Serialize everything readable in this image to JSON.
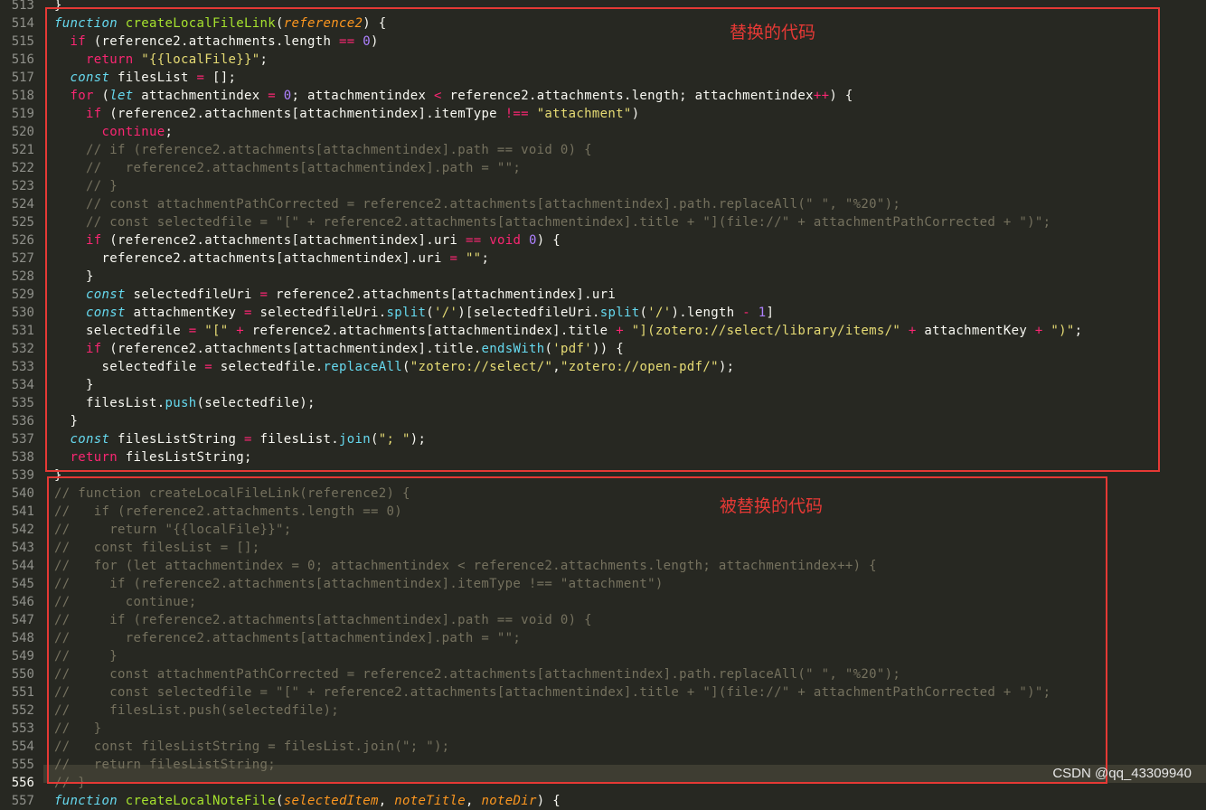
{
  "line_numbers": [
    "513",
    "514",
    "515",
    "516",
    "517",
    "518",
    "519",
    "520",
    "521",
    "522",
    "523",
    "524",
    "525",
    "526",
    "527",
    "528",
    "529",
    "530",
    "531",
    "532",
    "533",
    "534",
    "535",
    "536",
    "537",
    "538",
    "539",
    "540",
    "541",
    "542",
    "543",
    "544",
    "545",
    "546",
    "547",
    "548",
    "549",
    "550",
    "551",
    "552",
    "553",
    "554",
    "555",
    "556",
    "557"
  ],
  "current_line": "556",
  "code_lines": [
    "}",
    "function createLocalFileLink(reference2) {",
    "  if (reference2.attachments.length == 0)",
    "    return \"{{localFile}}\";",
    "  const filesList = [];",
    "  for (let attachmentindex = 0; attachmentindex < reference2.attachments.length; attachmentindex++) {",
    "    if (reference2.attachments[attachmentindex].itemType !== \"attachment\")",
    "      continue;",
    "    // if (reference2.attachments[attachmentindex].path == void 0) {",
    "    //   reference2.attachments[attachmentindex].path = \"\";",
    "    // }",
    "    // const attachmentPathCorrected = reference2.attachments[attachmentindex].path.replaceAll(\" \", \"%20\");",
    "    // const selectedfile = \"[\" + reference2.attachments[attachmentindex].title + \"](file://\" + attachmentPathCorrected + \")\";",
    "    if (reference2.attachments[attachmentindex].uri == void 0) {",
    "      reference2.attachments[attachmentindex].uri = \"\";",
    "    }",
    "    const selectedfileUri = reference2.attachments[attachmentindex].uri",
    "    const attachmentKey = selectedfileUri.split('/')[selectedfileUri.split('/').length - 1]",
    "    selectedfile = \"[\" + reference2.attachments[attachmentindex].title + \"](zotero://select/library/items/\" + attachmentKey + \")\";",
    "    if (reference2.attachments[attachmentindex].title.endsWith('pdf')) {",
    "      selectedfile = selectedfile.replaceAll(\"zotero://select/\",\"zotero://open-pdf/\");",
    "    }",
    "    filesList.push(selectedfile);",
    "  }",
    "  const filesListString = filesList.join(\"; \");",
    "  return filesListString;",
    "}",
    "// function createLocalFileLink(reference2) {",
    "//   if (reference2.attachments.length == 0)",
    "//     return \"{{localFile}}\";",
    "//   const filesList = [];",
    "//   for (let attachmentindex = 0; attachmentindex < reference2.attachments.length; attachmentindex++) {",
    "//     if (reference2.attachments[attachmentindex].itemType !== \"attachment\")",
    "//       continue;",
    "//     if (reference2.attachments[attachmentindex].path == void 0) {",
    "//       reference2.attachments[attachmentindex].path = \"\";",
    "//     }",
    "//     const attachmentPathCorrected = reference2.attachments[attachmentindex].path.replaceAll(\" \", \"%20\");",
    "//     const selectedfile = \"[\" + reference2.attachments[attachmentindex].title + \"](file://\" + attachmentPathCorrected + \")\";",
    "//     filesList.push(selectedfile);",
    "//   }",
    "//   const filesListString = filesList.join(\"; \");",
    "//   return filesListString;",
    "// }",
    "function createLocalNoteFile(selectedItem, noteTitle, noteDir) {"
  ],
  "annotations": {
    "replacement_label": "替换的代码",
    "replaced_label": "被替换的代码"
  },
  "watermark": "CSDN @qq_43309940",
  "colors": {
    "background": "#272822",
    "keyword": "#f92672",
    "storage": "#66d9ef",
    "function_name": "#a6e22e",
    "string": "#e6db74",
    "number": "#ae81ff",
    "comment": "#75715e",
    "annotation": "#e53935"
  }
}
